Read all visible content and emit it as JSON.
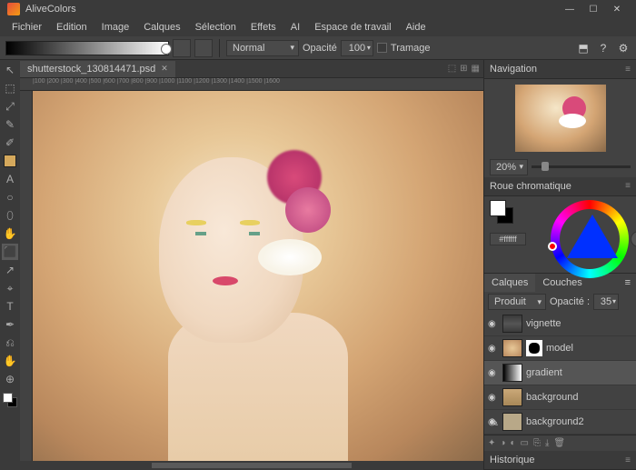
{
  "app": {
    "title": "AliveColors"
  },
  "window": {
    "min": "—",
    "max": "☐",
    "close": "✕"
  },
  "menu": [
    "Fichier",
    "Edition",
    "Image",
    "Calques",
    "Sélection",
    "Effets",
    "AI",
    "Espace de travail",
    "Aide"
  ],
  "toolbar": {
    "blend": "Normal",
    "opacity_label": "Opacité",
    "opacity_value": "100",
    "dither_label": "Tramage"
  },
  "tab": {
    "name": "shutterstock_130814471.psd"
  },
  "ruler": "|100    |200    |300    |400    |500    |600    |700    |800    |900    |1000   |1100   |1200   |1300   |1400   |1500   |1600",
  "panels": {
    "nav": {
      "title": "Navigation",
      "zoom": "20%"
    },
    "color": {
      "title": "Roue chromatique",
      "hex": "#ffffff"
    },
    "layers": {
      "tab1": "Calques",
      "tab2": "Couches",
      "blend": "Produit",
      "opacity_label": "Opacité :",
      "opacity_value": "35",
      "items": [
        {
          "name": "vignette",
          "thumb": "v",
          "mask": false
        },
        {
          "name": "model",
          "thumb": "m",
          "mask": true
        },
        {
          "name": "gradient",
          "thumb": "g",
          "mask": false,
          "sel": true
        },
        {
          "name": "background",
          "thumb": "bg",
          "mask": false
        },
        {
          "name": "background2",
          "thumb": "bg2",
          "mask": false
        }
      ]
    },
    "history": {
      "title": "Historique"
    }
  },
  "ltools": [
    "↖",
    "⬚",
    "⤢",
    "✎",
    "✐",
    "〰",
    "A",
    "○",
    "⬯",
    "✋",
    "⬛",
    "↗",
    "⌖",
    "T",
    "✒",
    "⎌",
    "✋",
    "⊕"
  ]
}
